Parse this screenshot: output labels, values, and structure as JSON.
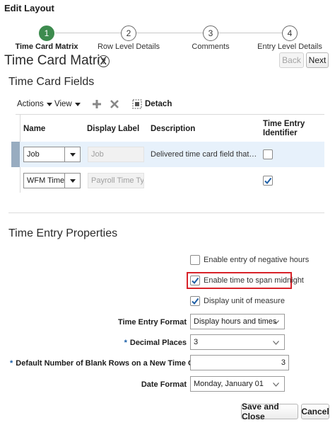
{
  "header": {
    "title": "Edit Layout"
  },
  "train": {
    "steps": [
      {
        "number": "1",
        "label": "Time Card Matrix"
      },
      {
        "number": "2",
        "label": "Row Level Details"
      },
      {
        "number": "3",
        "label": "Comments"
      },
      {
        "number": "4",
        "label": "Entry Level Details"
      }
    ]
  },
  "page": {
    "title": "Time Card Matrix",
    "help_glyph": "?",
    "back_label": "Back",
    "next_label": "Next"
  },
  "fields_section": {
    "title": "Time Card Fields",
    "toolbar": {
      "actions_label": "Actions",
      "view_label": "View",
      "detach_label": "Detach"
    },
    "columns": [
      "Name",
      "Display Label",
      "Description",
      "Time Entry Identifier"
    ],
    "rows": [
      {
        "name": "Job",
        "display_label": "Job",
        "description": "Delivered time card field that disp...",
        "time_entry_identifier": false
      },
      {
        "name": "WFM Time C",
        "display_label": "Payroll Time Type",
        "description": "",
        "time_entry_identifier": true
      }
    ]
  },
  "properties_section": {
    "title": "Time Entry Properties",
    "checkboxes": [
      {
        "label": "Enable entry of negative hours",
        "checked": false
      },
      {
        "label": "Enable time to span midnight",
        "checked": true
      },
      {
        "label": "Display unit of measure",
        "checked": true
      }
    ],
    "time_entry_format": {
      "label": "Time Entry Format",
      "value": "Display hours and times"
    },
    "decimal_places": {
      "label": "Decimal Places",
      "value": "3"
    },
    "blank_rows": {
      "label": "Default Number of Blank Rows on a New Time Card",
      "value": "3"
    },
    "date_format": {
      "label": "Date Format",
      "value": "Monday, January 01"
    },
    "required_mark": "*"
  },
  "footer": {
    "save_close_label": "Save and Close",
    "cancel_label": "Cancel"
  },
  "colors": {
    "accent_green": "#3d8b4e",
    "highlight_red": "#d8232a",
    "check_blue": "#1f5fa6"
  }
}
